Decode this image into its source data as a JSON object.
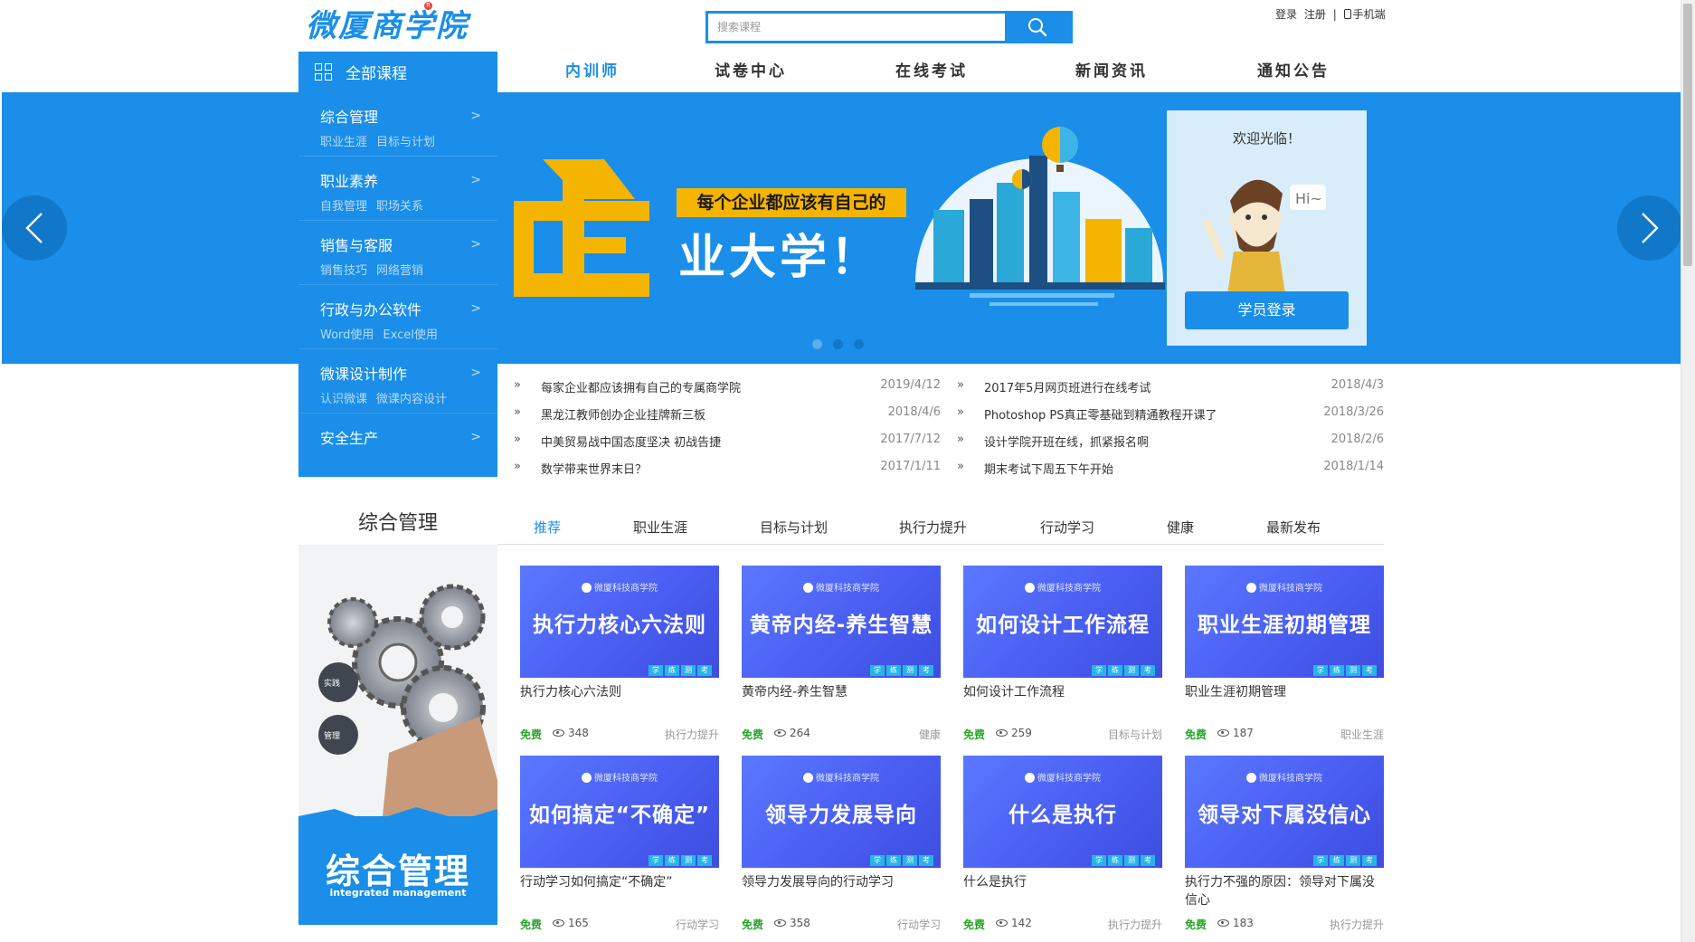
{
  "header": {
    "logo_text": "微厦商学院",
    "search_placeholder": "搜索课程",
    "login": "登录",
    "register": "注册",
    "separator": "|",
    "mobile": "手机端"
  },
  "nav": {
    "all_courses": "全部课程",
    "items": [
      "内训师",
      "试卷中心",
      "在线考试",
      "新闻资讯",
      "通知公告"
    ],
    "active_index": 0
  },
  "categories": [
    {
      "title": "综合管理",
      "subs": [
        "职业生涯",
        "目标与计划"
      ]
    },
    {
      "title": "职业素养",
      "subs": [
        "自我管理",
        "职场关系"
      ]
    },
    {
      "title": "销售与客服",
      "subs": [
        "销售技巧",
        "网络营销"
      ]
    },
    {
      "title": "行政与办公软件",
      "subs": [
        "Word使用",
        "Excel使用"
      ]
    },
    {
      "title": "微课设计制作",
      "subs": [
        "认识微课",
        "微课内容设计"
      ]
    },
    {
      "title": "安全生产",
      "subs": []
    }
  ],
  "category_arrow": ">",
  "banner": {
    "headline_big": "企",
    "headline_line1": "每个企业都应该有自己的",
    "headline_line2": "业大学！",
    "slide_count": 3,
    "active_slide": 1,
    "colors": {
      "bg": "#1a8ee8",
      "accent": "#f5b400"
    }
  },
  "welcome": {
    "title": "欢迎光临！",
    "bubble": "Hi~",
    "login_button": "学员登录"
  },
  "news_left": [
    {
      "title": "每家企业都应该拥有自己的专属商学院",
      "date": "2019/4/12"
    },
    {
      "title": "黑龙江教师创办企业挂牌新三板",
      "date": "2018/4/6"
    },
    {
      "title": "中美贸易战中国态度坚决 初战告捷",
      "date": "2017/7/12"
    },
    {
      "title": "数学带来世界末日？",
      "date": "2017/1/11"
    }
  ],
  "news_right": [
    {
      "title": "2017年5月网页班进行在线考试",
      "date": "2018/4/3"
    },
    {
      "title": "Photoshop PS真正零基础到精通教程开课了",
      "date": "2018/3/26"
    },
    {
      "title": "设计学院开班在线，抓紧报名啊",
      "date": "2018/2/6"
    },
    {
      "title": "期末考试下周五下午开始",
      "date": "2018/1/14"
    }
  ],
  "news_bullet": "»",
  "section": {
    "title": "综合管理",
    "tabs": [
      "推荐",
      "职业生涯",
      "目标与计划",
      "执行力提升",
      "行动学习",
      "健康",
      "最新发布"
    ],
    "active_tab": 0,
    "promo_title": "综合管理",
    "promo_subtitle": "integrated management",
    "promo_badge1": "实践",
    "promo_badge2": "管理"
  },
  "card_brand": "微厦科技商学院",
  "card_tags": [
    "学",
    "练",
    "测",
    "考"
  ],
  "free_label": "免费",
  "courses": [
    {
      "thumb": "执行力核心六法则",
      "name": "执行力核心六法则",
      "views": "348",
      "category": "执行力提升"
    },
    {
      "thumb": "黄帝内经-养生智慧",
      "name": "黄帝内经-养生智慧",
      "views": "264",
      "category": "健康"
    },
    {
      "thumb": "如何设计工作流程",
      "name": "如何设计工作流程",
      "views": "259",
      "category": "目标与计划"
    },
    {
      "thumb": "职业生涯初期管理",
      "name": "职业生涯初期管理",
      "views": "187",
      "category": "职业生涯"
    },
    {
      "thumb": "如何搞定“不确定”",
      "name": "行动学习如何搞定“不确定”",
      "views": "165",
      "category": "行动学习"
    },
    {
      "thumb": "领导力发展导向",
      "name": "领导力发展导向的行动学习",
      "views": "358",
      "category": "行动学习"
    },
    {
      "thumb": "什么是执行",
      "name": "什么是执行",
      "views": "142",
      "category": "执行力提升"
    },
    {
      "thumb": "领导对下属没信心",
      "name": "执行力不强的原因：领导对下属没信心",
      "views": "183",
      "category": "执行力提升"
    }
  ]
}
